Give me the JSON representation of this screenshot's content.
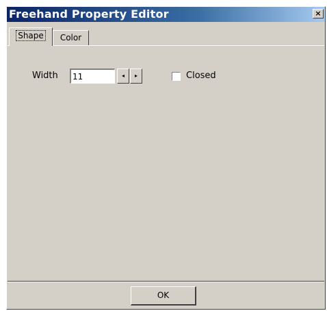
{
  "window": {
    "title": "Freehand Property Editor",
    "close_glyph": "×"
  },
  "tabs": [
    {
      "label": "Shape",
      "selected": true
    },
    {
      "label": "Color",
      "selected": false
    }
  ],
  "shape_panel": {
    "width_label": "Width",
    "width_value": "11",
    "spin_left_glyph": "◂",
    "spin_right_glyph": "▸",
    "closed_label": "Closed",
    "closed_checked": false
  },
  "footer": {
    "ok_label": "OK"
  },
  "colors": {
    "face": "#d4d0c8",
    "title_start": "#0a246a",
    "title_end": "#a6caf0"
  },
  "icons": {
    "close": "close-icon",
    "spin_left": "spin-left-arrow-icon",
    "spin_right": "spin-right-arrow-icon"
  }
}
